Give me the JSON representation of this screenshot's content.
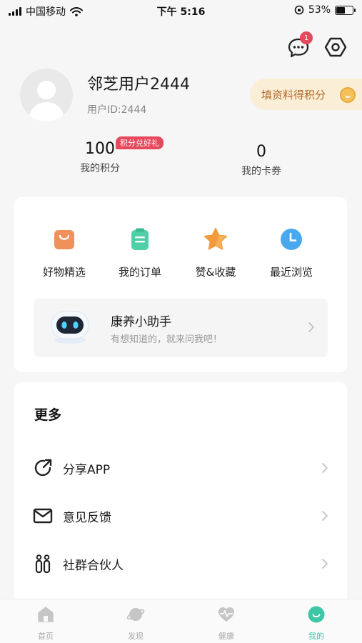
{
  "status_bar": {
    "carrier": "中国移动",
    "time": "下午 5:16",
    "battery_percent": "53%",
    "battery_level": 0.53
  },
  "header": {
    "message_badge_count": "1"
  },
  "profile": {
    "username": "邻芝用户2444",
    "user_id": "用户ID:2444",
    "fill_profile_label": "填资料得积分"
  },
  "stats": {
    "points_value": "100",
    "points_label": "我的积分",
    "points_tag": "积分兑好礼",
    "cards_value": "0",
    "cards_label": "我的卡券"
  },
  "shortcuts": [
    {
      "label": "好物精选",
      "icon": "shopping-bag-icon",
      "color": "#f0905a"
    },
    {
      "label": "我的订单",
      "icon": "clipboard-icon",
      "color": "#4fcfa8"
    },
    {
      "label": "赞&收藏",
      "icon": "star-icon",
      "color": "#f39a3d"
    },
    {
      "label": "最近浏览",
      "icon": "clock-icon",
      "color": "#4aa8ee"
    }
  ],
  "assistant": {
    "title": "康养小助手",
    "subtitle": "有想知道的，就来问我吧！"
  },
  "more": {
    "title": "更多",
    "items": [
      {
        "label": "分享APP",
        "icon": "share-icon"
      },
      {
        "label": "意见反馈",
        "icon": "mail-icon"
      },
      {
        "label": "社群合伙人",
        "icon": "people-icon"
      }
    ]
  },
  "tabbar": {
    "tabs": [
      {
        "label": "首页",
        "icon": "home-icon"
      },
      {
        "label": "发现",
        "icon": "planet-icon"
      },
      {
        "label": "健康",
        "icon": "heartbeat-icon"
      },
      {
        "label": "我的",
        "icon": "smile-icon"
      }
    ],
    "active_index": 3
  },
  "colors": {
    "accent": "#3ec6a6",
    "badge_red": "#e8485b",
    "fill_profile_bg": "#fbeed6",
    "fill_profile_text": "#b36a2a"
  }
}
